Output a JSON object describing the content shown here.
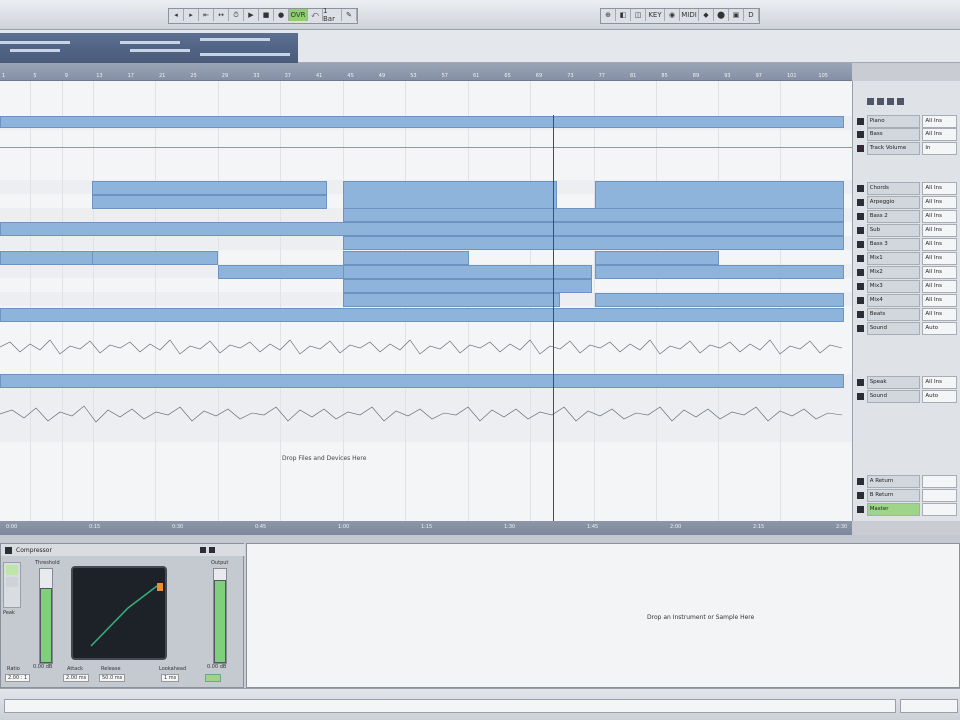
{
  "toolbar": {
    "left_buttons": [
      "◂",
      "▸",
      "⇤",
      "↔",
      "⏱",
      "▶",
      "■",
      "●",
      "OVR",
      "⤺",
      "1 Bar",
      "✎"
    ],
    "right_buttons": [
      "⊕",
      "◧",
      "◫",
      "KEY",
      "◉",
      "MIDI",
      "◆",
      "⬤",
      "▣",
      "D"
    ]
  },
  "ruler": {
    "ticks": [
      "1",
      "5",
      "9",
      "13",
      "17",
      "21",
      "25",
      "29",
      "33",
      "37",
      "41",
      "45",
      "49",
      "53",
      "57",
      "61",
      "65",
      "69",
      "73",
      "77",
      "81",
      "85",
      "89",
      "93",
      "97",
      "101",
      "105"
    ]
  },
  "tracks": [
    {
      "name": "Piano",
      "value": "All Ins"
    },
    {
      "name": "Bass",
      "value": "All Ins"
    },
    {
      "name": "Track Volume",
      "value": "In"
    },
    {
      "name": "Chords",
      "value": "All Ins"
    },
    {
      "name": "Arpeggio",
      "value": "All Ins"
    },
    {
      "name": "Bass 2",
      "value": "All Ins"
    },
    {
      "name": "Sub",
      "value": "All Ins"
    },
    {
      "name": "Bass 3",
      "value": "All Ins"
    },
    {
      "name": "Mix1",
      "value": "All Ins"
    },
    {
      "name": "Mix2",
      "value": "All Ins"
    },
    {
      "name": "Mix3",
      "value": "All Ins"
    },
    {
      "name": "Mix4",
      "value": "All Ins"
    },
    {
      "name": "Beats",
      "value": "All Ins"
    },
    {
      "name": "Sound",
      "value": "Auto"
    },
    {
      "name": "Speak",
      "value": "All Ins"
    },
    {
      "name": "Sound",
      "value": "Auto"
    },
    {
      "name": "A Return",
      "value": ""
    },
    {
      "name": "B Return",
      "value": ""
    },
    {
      "name": "Master",
      "value": ""
    }
  ],
  "arrangement": {
    "drop_text": "Drop Files and Devices Here"
  },
  "status": {
    "ticks": [
      "0:00",
      "0:15",
      "0:30",
      "0:45",
      "1:00",
      "1:15",
      "1:30",
      "1:45",
      "2:00",
      "2:15",
      "2:30"
    ]
  },
  "device": {
    "title": "Compressor",
    "threshold_label": "Threshold",
    "output_label": "Output",
    "ratio_label": "Ratio",
    "attack_label": "Attack",
    "release_label": "Release",
    "lookahead_label": "Lookahead",
    "ratio_value": "2.00 : 1",
    "attack_value": "2.00 ms",
    "release_value": "50.0 ms",
    "lookahead_value": "1 ms",
    "threshold_value": "0.00 dB",
    "output_value": "0.00 dB",
    "mode_value": "Peak"
  },
  "clip_panel": {
    "drop_text": "Drop an Instrument or Sample Here"
  },
  "colors": {
    "clip": "#8fb4dc",
    "meter": "#7fd07a",
    "accent": "#5b6f92"
  }
}
